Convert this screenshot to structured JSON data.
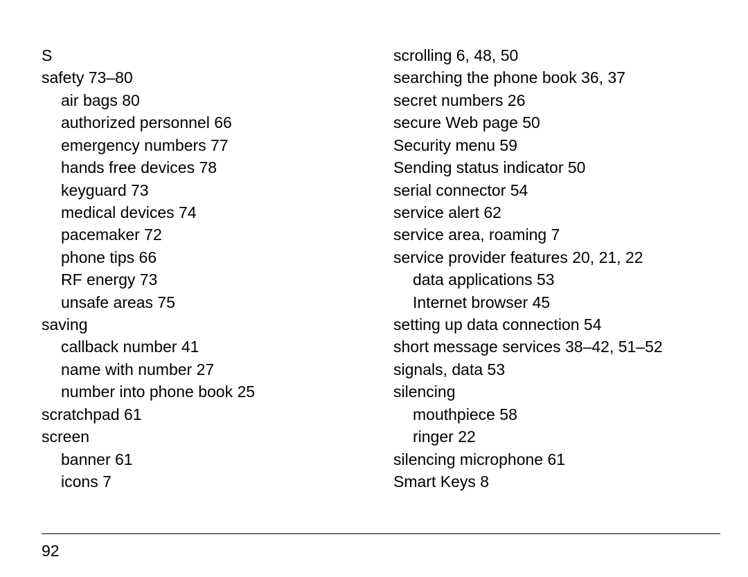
{
  "page_number": "92",
  "left": {
    "heading": "S",
    "entries": [
      {
        "text": "safety 73–80",
        "indent": 0
      },
      {
        "text": "air bags 80",
        "indent": 1
      },
      {
        "text": "authorized personnel 66",
        "indent": 1
      },
      {
        "text": "emergency numbers 77",
        "indent": 1
      },
      {
        "text": "hands free devices 78",
        "indent": 1
      },
      {
        "text": "keyguard 73",
        "indent": 1
      },
      {
        "text": "medical devices 74",
        "indent": 1
      },
      {
        "text": "pacemaker 72",
        "indent": 1
      },
      {
        "text": "phone tips 66",
        "indent": 1
      },
      {
        "text": "RF energy 73",
        "indent": 1
      },
      {
        "text": "unsafe areas 75",
        "indent": 1
      },
      {
        "text": "saving",
        "indent": 0
      },
      {
        "text": "callback number 41",
        "indent": 1
      },
      {
        "text": "name with number 27",
        "indent": 1
      },
      {
        "text": "number into phone book 25",
        "indent": 1
      },
      {
        "text": "scratchpad 61",
        "indent": 0
      },
      {
        "text": "screen",
        "indent": 0
      },
      {
        "text": "banner 61",
        "indent": 1
      },
      {
        "text": "icons 7",
        "indent": 1
      }
    ]
  },
  "right": {
    "entries": [
      {
        "text": "scrolling 6, 48, 50",
        "indent": 0
      },
      {
        "text": "searching the phone book 36, 37",
        "indent": 0
      },
      {
        "text": "secret numbers 26",
        "indent": 0
      },
      {
        "text": "secure Web page 50",
        "indent": 0
      },
      {
        "text": "Security menu 59",
        "indent": 0
      },
      {
        "text": "Sending status indicator 50",
        "indent": 0
      },
      {
        "text": "serial connector 54",
        "indent": 0
      },
      {
        "text": "service alert 62",
        "indent": 0
      },
      {
        "text": "service area, roaming 7",
        "indent": 0
      },
      {
        "text": "service provider features 20, 21, 22",
        "indent": 0
      },
      {
        "text": "data applications 53",
        "indent": 1
      },
      {
        "text": "Internet browser 45",
        "indent": 1
      },
      {
        "text": "setting up data connection 54",
        "indent": 0
      },
      {
        "text": "short message services 38–42, 51–52",
        "indent": 0
      },
      {
        "text": "signals, data 53",
        "indent": 0
      },
      {
        "text": "silencing",
        "indent": 0
      },
      {
        "text": "mouthpiece 58",
        "indent": 1
      },
      {
        "text": "ringer 22",
        "indent": 1
      },
      {
        "text": "silencing microphone 61",
        "indent": 0
      },
      {
        "text": "Smart Keys 8",
        "indent": 0
      }
    ]
  }
}
